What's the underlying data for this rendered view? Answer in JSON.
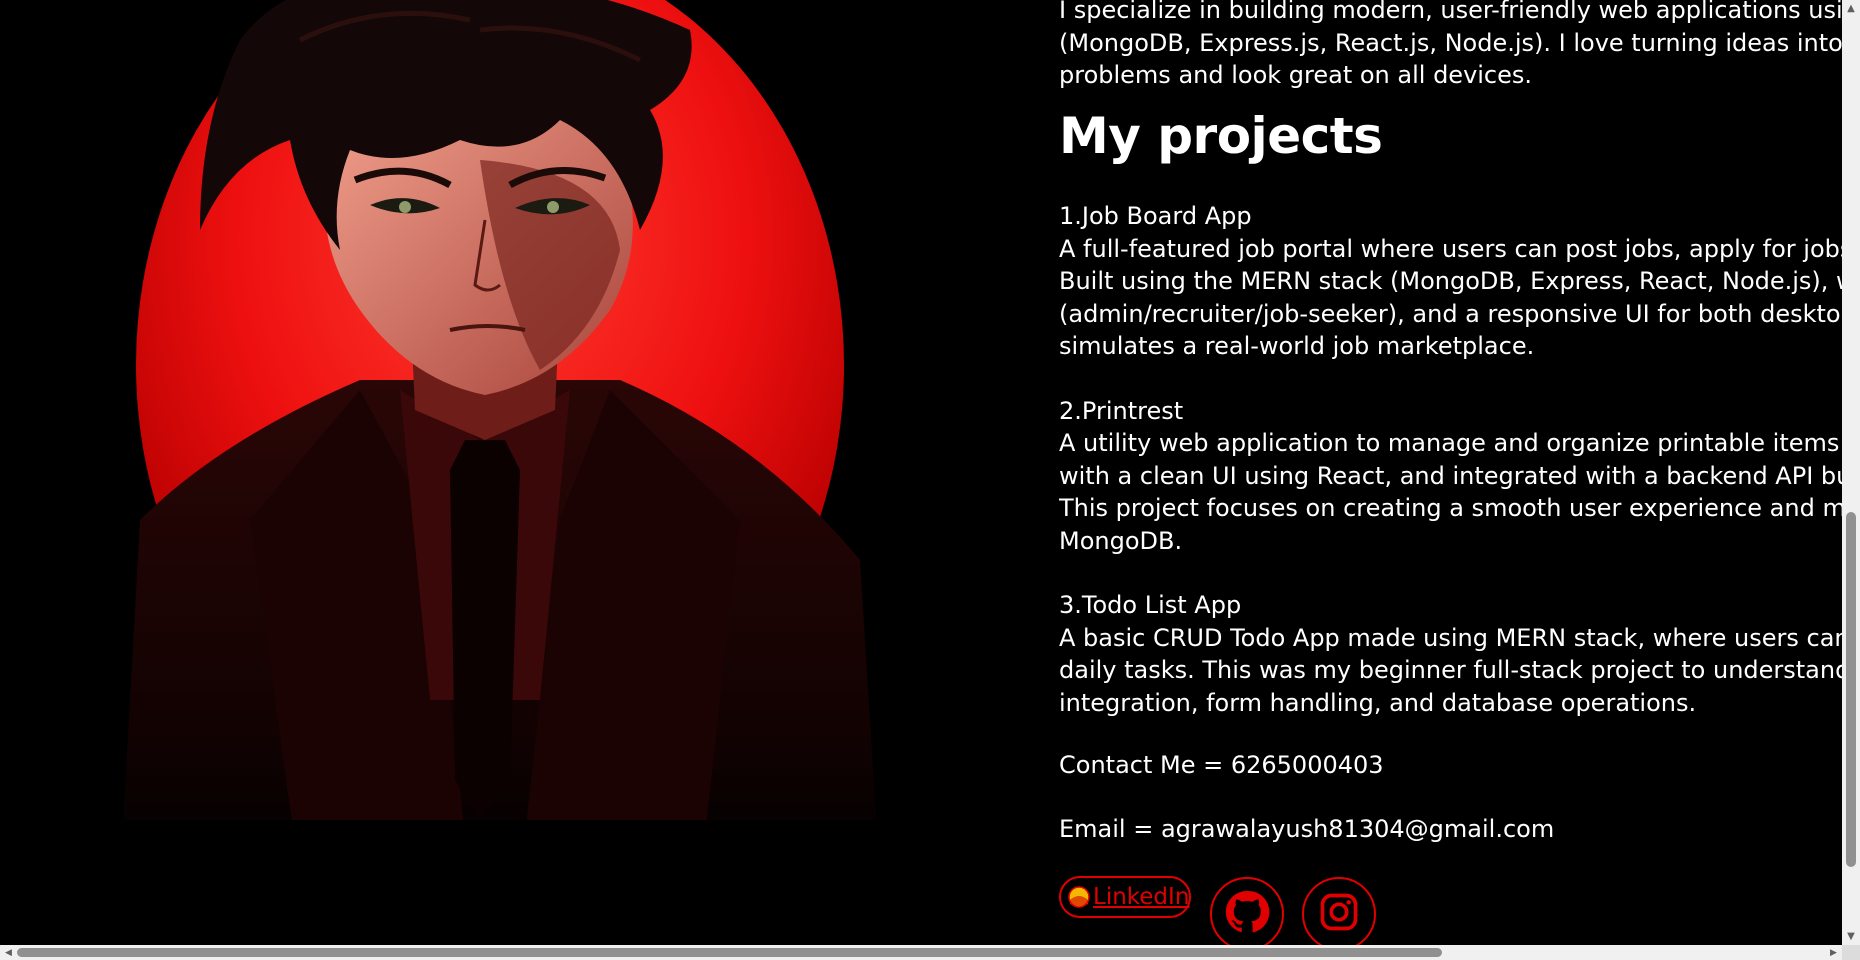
{
  "intro": {
    "lines": [
      "I specialize in building modern, user-friendly web applications using the MERN stack",
      "(MongoDB, Express.js, React.js, Node.js). I love turning ideas into real-world products that solve",
      "problems and look great on all devices."
    ]
  },
  "heading": "My projects",
  "projects": [
    {
      "title": "1.Job Board App",
      "lines": [
        "A full-featured job portal where users can post jobs, apply for jobs, and manage applications.",
        "Built using the MERN stack (MongoDB, Express, React, Node.js), with role-based access",
        "(admin/recruiter/job-seeker), and a responsive UI for both desktop and mobile. This project",
        "simulates a real-world job marketplace."
      ]
    },
    {
      "title": "2.Printrest",
      "lines": [
        "A utility web application to manage and organize printable items or design templates. Built",
        "with a clean UI using React, and integrated with a backend API built on Node.js and Express.",
        "This project focuses on creating a smooth user experience and managing data efficiently with",
        "MongoDB."
      ]
    },
    {
      "title": "3.Todo List App",
      "lines": [
        "A basic CRUD Todo App made using MERN stack, where users can add, update, and delete their",
        "daily tasks. This was my beginner full-stack project to understand frontend and backend",
        "integration, form handling, and database operations."
      ]
    }
  ],
  "contact": "Contact Me = 6265000403",
  "email": "Email = agrawalayush81304@gmail.com",
  "socials": {
    "linkedin_label": "LinkedIn",
    "github_icon": "github-icon",
    "instagram_icon": "instagram-icon"
  },
  "colors": {
    "background": "#000000",
    "accent": "#e00000",
    "portrait_red": "#ff1a1a"
  }
}
